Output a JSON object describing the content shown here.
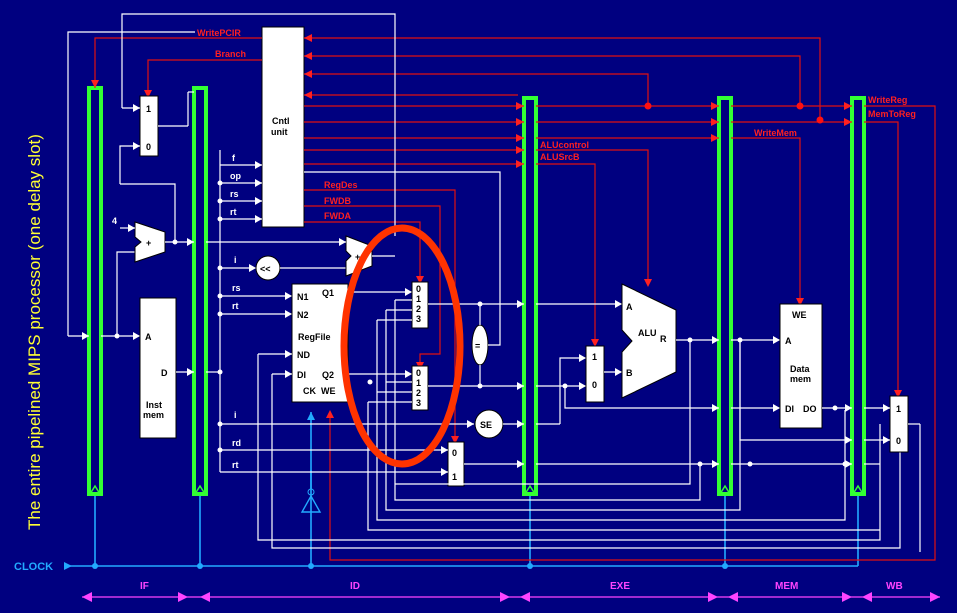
{
  "title": "The entire pipelined MIPS processor (one delay slot)",
  "clock_label": "CLOCK",
  "stages": [
    "IF",
    "ID",
    "EXE",
    "MEM",
    "WB"
  ],
  "control_signals": {
    "write_pcir": "WritePCIR",
    "branch": "Branch",
    "regdes": "RegDes",
    "fwdb": "FWDB",
    "fwda": "FWDA",
    "alucontrol": "ALUcontrol",
    "alusrcb": "ALUSrcB",
    "writemem": "WriteMem",
    "writereg": "WriteReg",
    "memtoreg": "MemToReg"
  },
  "cntl_unit": {
    "line1": "Cntl",
    "line2": "unit"
  },
  "cntl_inputs": [
    "f",
    "op",
    "rs",
    "rt"
  ],
  "id_fields": {
    "i": "i",
    "rs": "rs",
    "rt": "rt",
    "i2": "i",
    "rd": "rd",
    "rt2": "rt"
  },
  "const_four": "4",
  "plus": "+",
  "shift": "<<",
  "inst_mem": {
    "a": "A",
    "d": "D",
    "name1": "Inst",
    "name2": "mem"
  },
  "regfile": {
    "n1": "N1",
    "n2": "N2",
    "nd": "ND",
    "di": "DI",
    "q1": "Q1",
    "q2": "Q2",
    "name": "RegFile",
    "ck": "CK",
    "we": "WE"
  },
  "mux_0123": [
    "0",
    "1",
    "2",
    "3"
  ],
  "mux_01": [
    "0",
    "1"
  ],
  "mux_10": [
    "1",
    "0"
  ],
  "compare": "=",
  "se": "SE",
  "alu": {
    "name": "ALU",
    "a": "A",
    "b": "B",
    "r": "R"
  },
  "data_mem": {
    "we": "WE",
    "a": "A",
    "name1": "Data",
    "name2": "mem",
    "di": "DI",
    "do": "DO"
  }
}
